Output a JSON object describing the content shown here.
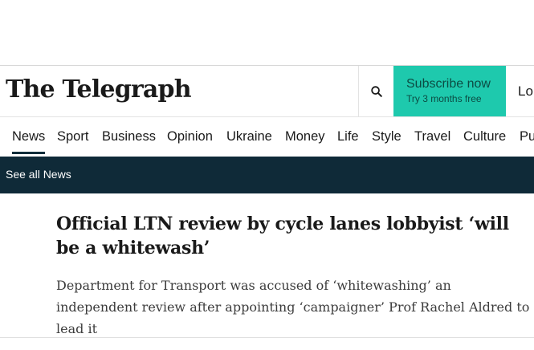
{
  "header": {
    "logo_text": "The Telegraph",
    "search_icon": "search-icon",
    "subscribe": {
      "title": "Subscribe now",
      "subtitle": "Try 3 months free",
      "background": "#1ec9ad"
    },
    "login_label": "Lo"
  },
  "nav": {
    "items": [
      {
        "label": "News",
        "active": true
      },
      {
        "label": "Sport"
      },
      {
        "label": "Business"
      },
      {
        "label": "Opinion"
      },
      {
        "label": "Ukraine"
      },
      {
        "label": "Money"
      },
      {
        "label": "Life"
      },
      {
        "label": "Style"
      },
      {
        "label": "Travel"
      },
      {
        "label": "Culture"
      },
      {
        "label": "Pu"
      }
    ]
  },
  "subnav": {
    "link": "See all News",
    "background": "#0f2a38"
  },
  "article": {
    "headline": "Official LTN review by cycle lanes lobbyist ‘will be a whitewash’",
    "standfirst": "Department for Transport was accused of ‘whitewashing’ an independent review after appointing ‘campaigner’ Prof Rachel Aldred to lead it"
  }
}
